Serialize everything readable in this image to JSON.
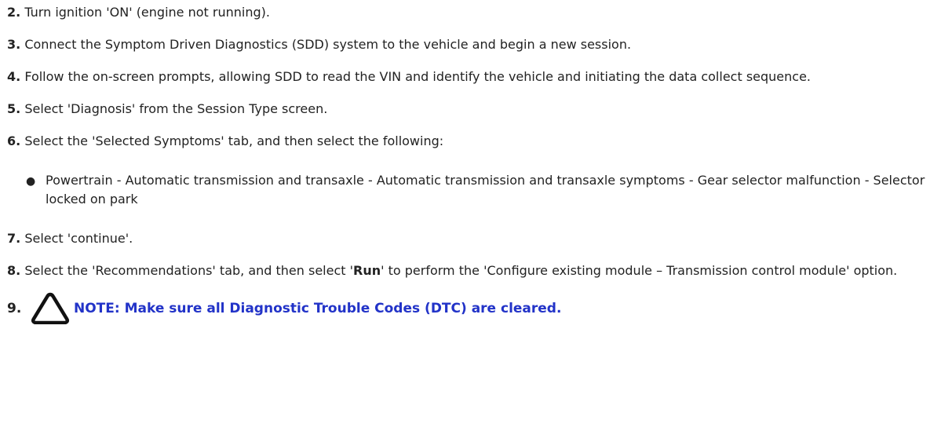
{
  "steps": [
    {
      "num": "2.",
      "text": "Turn ignition 'ON' (engine not running)."
    },
    {
      "num": "3.",
      "text": "Connect the Symptom Driven Diagnostics (SDD) system to the vehicle and begin a new session."
    },
    {
      "num": "4.",
      "text": "Follow the on-screen prompts, allowing SDD to read the VIN and identify the vehicle and initiating the data collect sequence."
    },
    {
      "num": "5.",
      "text": "Select 'Diagnosis' from the Session Type screen."
    },
    {
      "num": "6.",
      "text": "Select the 'Selected Symptoms' tab, and then select the following:"
    }
  ],
  "bullet_item": "Powertrain - Automatic transmission and transaxle - Automatic transmission and transaxle symptoms - Gear selector malfunction - Selector locked on park",
  "bullet_glyph": "●",
  "step7": {
    "num": "7.",
    "text": "Select 'continue'."
  },
  "step8": {
    "num": "8.",
    "text_before": "Select the 'Recommendations' tab, and then select '",
    "keyword": "Run",
    "text_after": "' to perform the 'Configure existing module – Transmission control module' option."
  },
  "step9": {
    "num": "9.",
    "icon": "warning-triangle-icon",
    "note_color": "#2233c8",
    "note": "NOTE: Make sure all Diagnostic Trouble Codes (DTC) are cleared."
  }
}
